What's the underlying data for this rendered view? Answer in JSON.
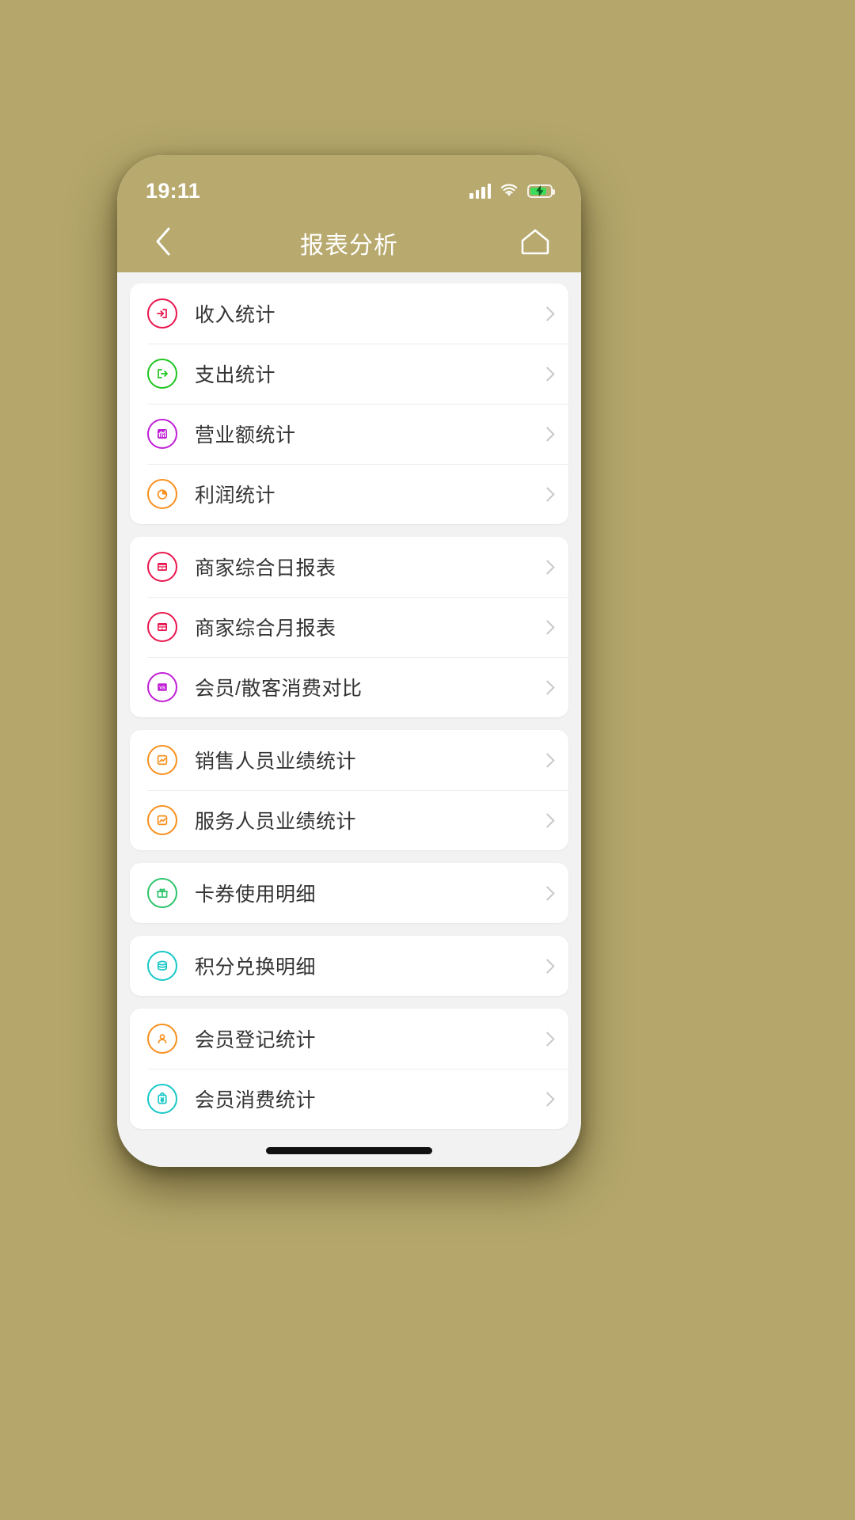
{
  "theme": {
    "page_background": "#b5a76b",
    "header_background": "#b8a96e",
    "content_background": "#f2f2f2",
    "card_background": "#ffffff",
    "label_color": "#333333",
    "chevron_color": "#c8c8c8",
    "battery_fill": "#3ddc5b"
  },
  "status_bar": {
    "time": "19:11",
    "signal_icon": "signal-bars-icon",
    "wifi_icon": "wifi-icon",
    "battery_icon": "battery-charging-icon",
    "battery_level_percent": 82
  },
  "nav_bar": {
    "back_icon": "chevron-left-icon",
    "title": "报表分析",
    "home_icon": "home-icon"
  },
  "groups": [
    {
      "group_name": "finance-statistics",
      "items": [
        {
          "label": "收入统计",
          "icon": "income-arrow-in-icon",
          "color": "#e8174e",
          "chevron": "chevron-right-icon"
        },
        {
          "label": "支出统计",
          "icon": "expense-arrow-out-icon",
          "color": "#1fc61f",
          "chevron": "chevron-right-icon"
        },
        {
          "label": "营业额统计",
          "icon": "turnover-chart-icon",
          "color": "#c01fd6",
          "chevron": "chevron-right-icon"
        },
        {
          "label": "利润统计",
          "icon": "profit-pie-icon",
          "color": "#f7901e",
          "chevron": "chevron-right-icon"
        }
      ]
    },
    {
      "group_name": "merchant-reports",
      "items": [
        {
          "label": "商家综合日报表",
          "icon": "daily-report-table-icon",
          "color": "#e8174e",
          "chevron": "chevron-right-icon"
        },
        {
          "label": "商家综合月报表",
          "icon": "monthly-report-table-icon",
          "color": "#e8174e",
          "chevron": "chevron-right-icon"
        },
        {
          "label": "会员/散客消费对比",
          "icon": "vs-compare-icon",
          "color": "#c01fd6",
          "chevron": "chevron-right-icon"
        }
      ]
    },
    {
      "group_name": "staff-performance",
      "items": [
        {
          "label": "销售人员业绩统计",
          "icon": "sales-performance-chart-icon",
          "color": "#f7901e",
          "chevron": "chevron-right-icon"
        },
        {
          "label": "服务人员业绩统计",
          "icon": "service-performance-chart-icon",
          "color": "#f7901e",
          "chevron": "chevron-right-icon"
        }
      ]
    },
    {
      "group_name": "coupon-usage",
      "items": [
        {
          "label": "卡券使用明细",
          "icon": "coupon-gift-icon",
          "color": "#2ec46b",
          "chevron": "chevron-right-icon"
        }
      ]
    },
    {
      "group_name": "points-exchange",
      "items": [
        {
          "label": "积分兑换明细",
          "icon": "points-database-icon",
          "color": "#19c7c7",
          "chevron": "chevron-right-icon"
        }
      ]
    },
    {
      "group_name": "member-statistics",
      "items": [
        {
          "label": "会员登记统计",
          "icon": "member-person-icon",
          "color": "#f7901e",
          "chevron": "chevron-right-icon"
        },
        {
          "label": "会员消费统计",
          "icon": "member-clipboard-yen-icon",
          "color": "#19c7c7",
          "chevron": "chevron-right-icon"
        }
      ]
    }
  ],
  "home_indicator": "home-indicator-bar"
}
